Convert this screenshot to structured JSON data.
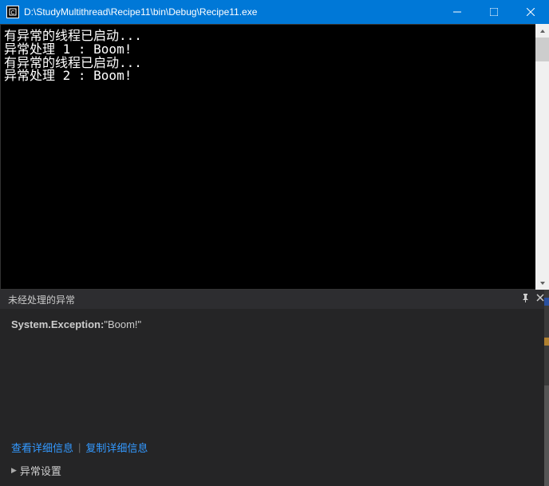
{
  "titlebar": {
    "title": "D:\\StudyMultithread\\Recipe11\\bin\\Debug\\Recipe11.exe"
  },
  "console": {
    "lines": [
      "有异常的线程已启动...",
      "异常处理 1 : Boom!",
      "有异常的线程已启动...",
      "异常处理 2 : Boom!"
    ]
  },
  "exceptionPanel": {
    "title": "未经处理的异常",
    "exceptionType": "System.Exception:",
    "exceptionMessage": "\"Boom!\"",
    "viewDetailsLabel": "查看详细信息",
    "copyDetailsLabel": "复制详细信息",
    "settingsLabel": "异常设置"
  }
}
